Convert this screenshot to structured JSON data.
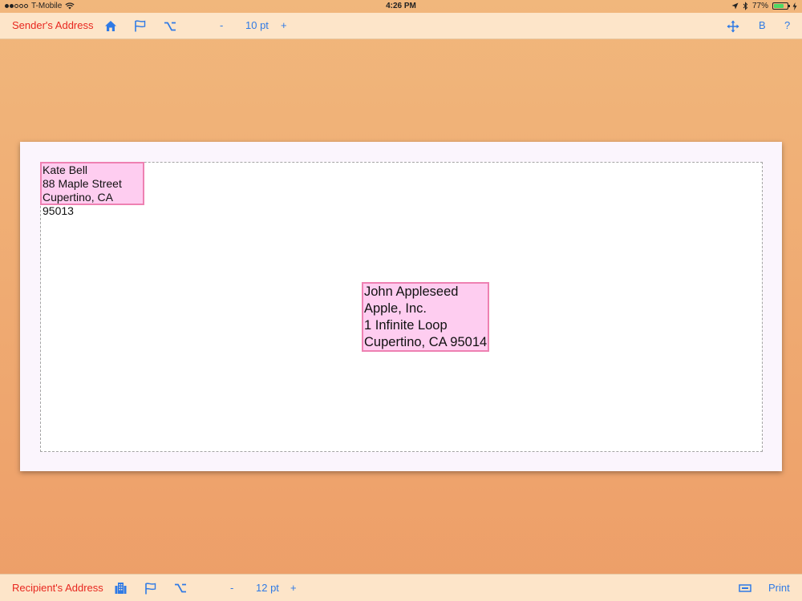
{
  "status": {
    "carrier": "T-Mobile",
    "time": "4:26 PM",
    "battery": "77%",
    "battery_level": 0.77
  },
  "top_toolbar": {
    "title": "Sender's Address",
    "decrease": "-",
    "font_size": "10 pt",
    "increase": "+",
    "bold": "B",
    "help": "?"
  },
  "bottom_toolbar": {
    "title": "Recipient's Address",
    "decrease": "-",
    "font_size": "12 pt",
    "increase": "+",
    "print": "Print"
  },
  "sender": {
    "lines": [
      "Kate Bell",
      "88 Maple Street",
      "Cupertino, CA 95013"
    ]
  },
  "recipient": {
    "lines": [
      "John Appleseed",
      "Apple, Inc.",
      "1 Infinite Loop",
      "Cupertino, CA 95014"
    ]
  },
  "icons": {
    "top": [
      "home-icon",
      "flag-icon",
      "option-key-icon",
      "move-arrows-icon"
    ],
    "bottom": [
      "building-icon",
      "flag-icon",
      "option-key-icon",
      "envelope-size-icon"
    ]
  },
  "colors": {
    "accent": "#2f7ae5",
    "title": "#e8271f",
    "toolbar": "#fde5c9",
    "address_fill": "#fecdf0",
    "address_border": "#ee81b2"
  }
}
